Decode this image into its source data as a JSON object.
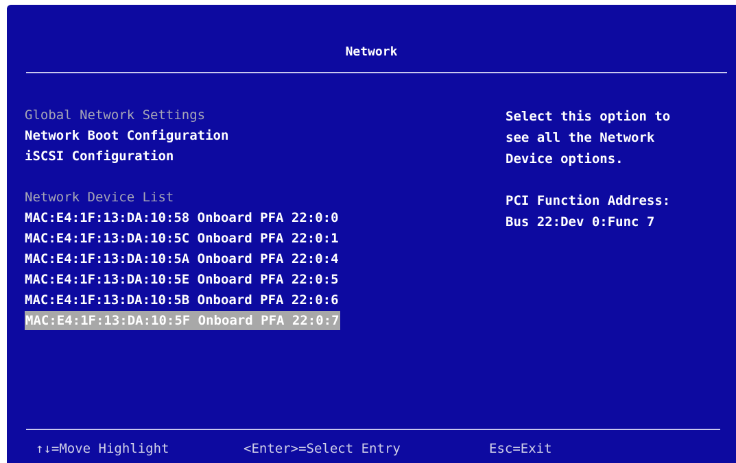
{
  "header": {
    "title": "Network"
  },
  "menu": {
    "items": [
      {
        "label": "Global Network Settings",
        "dimmed": true
      },
      {
        "label": "Network Boot Configuration",
        "dimmed": false
      },
      {
        "label": "iSCSI Configuration",
        "dimmed": false
      }
    ]
  },
  "device_list": {
    "heading": "Network Device List",
    "devices": [
      "MAC:E4:1F:13:DA:10:58 Onboard PFA 22:0:0",
      "MAC:E4:1F:13:DA:10:5C Onboard PFA 22:0:1",
      "MAC:E4:1F:13:DA:10:5A Onboard PFA 22:0:4",
      "MAC:E4:1F:13:DA:10:5E Onboard PFA 22:0:5",
      "MAC:E4:1F:13:DA:10:5B Onboard PFA 22:0:6",
      "MAC:E4:1F:13:DA:10:5F Onboard PFA 22:0:7"
    ],
    "selected_index": 5
  },
  "help": {
    "lines": [
      "Select this option to",
      "see all the Network",
      "Device options."
    ],
    "pci_label": "PCI Function Address:",
    "pci_value": "Bus 22:Dev 0:Func 7"
  },
  "footer": {
    "move": "↑↓=Move Highlight",
    "select": "<Enter>=Select Entry",
    "exit": "Esc=Exit"
  },
  "colors": {
    "background": "#0d0aa0",
    "highlight": "#a8a8a8",
    "dim_text": "#a6a6b6"
  }
}
